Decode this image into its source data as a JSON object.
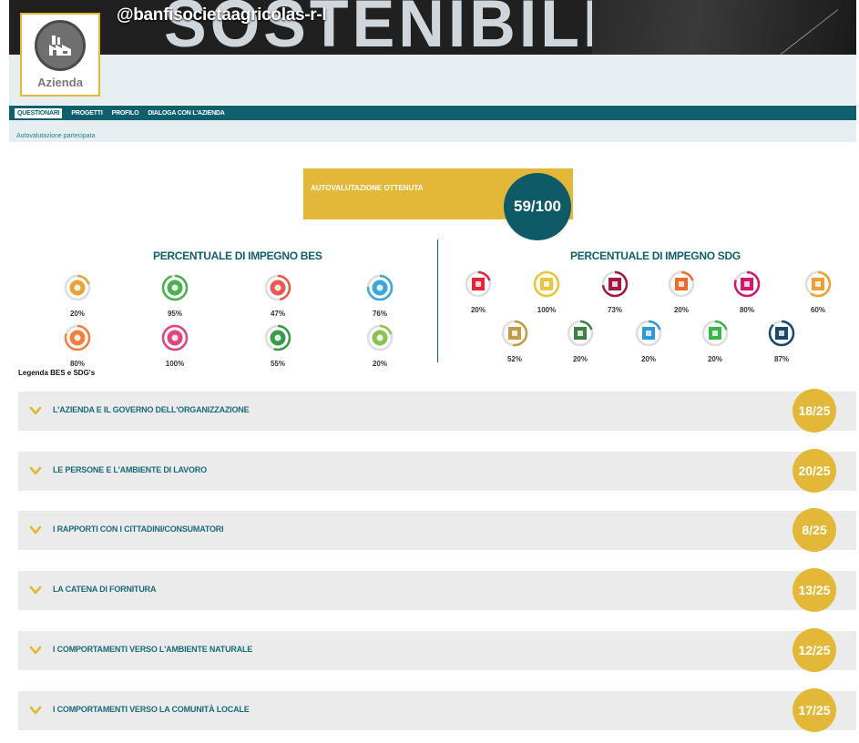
{
  "header": {
    "banner_word": "SOSTENIBILE",
    "handle": "@banfisocietaagricolas-r-l",
    "avatar_label": "Azienda",
    "avatar_icon": "factory-icon"
  },
  "nav": {
    "items": [
      "QUESTIONARI",
      "PROGETTI",
      "PROFILO",
      "DIALOGA CON L'AZIENDA"
    ],
    "active": "QUESTIONARI",
    "subnav": "Autovalutazione partecipata"
  },
  "score": {
    "label": "AUTOVALUTAZIONE OTTENUTA",
    "value": "59/100"
  },
  "bes": {
    "title": "PERCENTUALE DI IMPEGNO BES",
    "items": [
      {
        "pct": "20%",
        "value": 0.2,
        "color": "#e8a23a",
        "icon": "bes-health-icon"
      },
      {
        "pct": "95%",
        "value": 0.95,
        "color": "#4caf50",
        "icon": "bes-education-icon"
      },
      {
        "pct": "47%",
        "value": 0.47,
        "color": "#e85a4f",
        "icon": "bes-work-icon"
      },
      {
        "pct": "76%",
        "value": 0.76,
        "color": "#3aa8d8",
        "icon": "bes-wellbeing-icon"
      },
      {
        "pct": "80%",
        "value": 0.8,
        "color": "#f0803a",
        "icon": "bes-relations-icon"
      },
      {
        "pct": "100%",
        "value": 1.0,
        "color": "#e0457b",
        "icon": "bes-politics-icon"
      },
      {
        "pct": "55%",
        "value": 0.55,
        "color": "#3a9a4a",
        "icon": "bes-environment-icon"
      },
      {
        "pct": "20%",
        "value": 0.2,
        "color": "#8cc152",
        "icon": "bes-research-icon"
      }
    ]
  },
  "sdg": {
    "title": "PERCENTUALE DI IMPEGNO SDG",
    "items": [
      {
        "pct": "20%",
        "value": 0.2,
        "color": "#e5243b",
        "icon": "sdg-1-icon"
      },
      {
        "pct": "100%",
        "value": 1.0,
        "color": "#ecc53a",
        "icon": "sdg-2-icon"
      },
      {
        "pct": "73%",
        "value": 0.73,
        "color": "#a21942",
        "icon": "sdg-3-icon"
      },
      {
        "pct": "20%",
        "value": 0.2,
        "color": "#ef6b2b",
        "icon": "sdg-4-icon"
      },
      {
        "pct": "80%",
        "value": 0.8,
        "color": "#d6156f",
        "icon": "sdg-5-icon"
      },
      {
        "pct": "60%",
        "value": 0.6,
        "color": "#f0a030",
        "icon": "sdg-6-icon"
      },
      {
        "pct": "52%",
        "value": 0.52,
        "color": "#c39b48",
        "icon": "sdg-7-icon"
      },
      {
        "pct": "20%",
        "value": 0.2,
        "color": "#3f7e44",
        "icon": "sdg-8-icon"
      },
      {
        "pct": "20%",
        "value": 0.2,
        "color": "#2a9bd8",
        "icon": "sdg-9-icon"
      },
      {
        "pct": "20%",
        "value": 0.2,
        "color": "#3ab54a",
        "icon": "sdg-10-icon"
      },
      {
        "pct": "87%",
        "value": 0.87,
        "color": "#19486a",
        "icon": "sdg-11-icon"
      }
    ]
  },
  "legend": "Legenda BES e SDG's",
  "sections": [
    {
      "title": "L'AZIENDA E IL GOVERNO DELL'ORGANIZZAZIONE",
      "score": "18/25"
    },
    {
      "title": "LE PERSONE E L'AMBIENTE DI LAVORO",
      "score": "20/25"
    },
    {
      "title": "I RAPPORTI CON I CITTADINI/CONSUMATORI",
      "score": "8/25"
    },
    {
      "title": "LA CATENA DI FORNITURA",
      "score": "13/25"
    },
    {
      "title": "I COMPORTAMENTI VERSO L'AMBIENTE NATURALE",
      "score": "12/25"
    },
    {
      "title": "I COMPORTAMENTI VERSO LA COMUNITÀ LOCALE",
      "score": "17/25"
    }
  ],
  "colors": {
    "accent": "#e3b838",
    "teal": "#0f5f6e",
    "panel": "#ebebeb"
  }
}
